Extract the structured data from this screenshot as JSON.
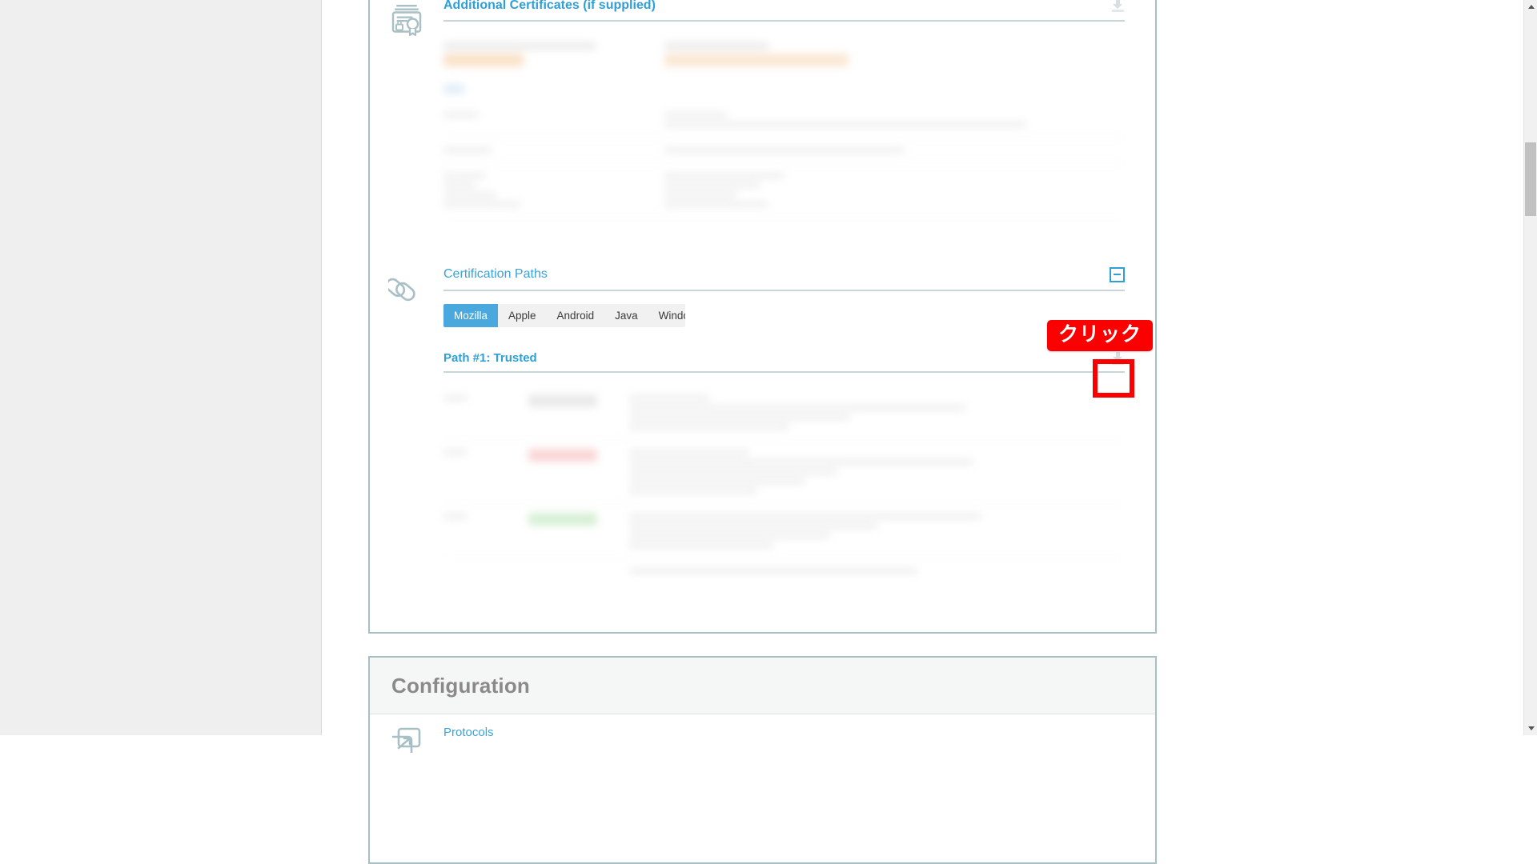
{
  "app": {
    "scroll_hint": "vertical-scrollbar"
  },
  "sections": {
    "additional_certificates": {
      "title": "Additional Certificates (if supplied)",
      "icon": "certificate-icon",
      "download_label": "",
      "content_state": "redacted"
    },
    "certification_paths": {
      "title": "Certification Paths",
      "icon": "chain-link-icon",
      "collapse_label": "",
      "tabs": [
        {
          "label": "Mozilla",
          "active": true
        },
        {
          "label": "Apple",
          "active": false
        },
        {
          "label": "Android",
          "active": false
        },
        {
          "label": "Java",
          "active": false
        },
        {
          "label": "Windows",
          "active": false
        }
      ],
      "path": {
        "title": "Path #1: Trusted",
        "download_label": "",
        "content_state": "redacted"
      }
    }
  },
  "configuration": {
    "title": "Configuration",
    "items": [
      {
        "label": "Protocols",
        "icon": "protocol-arrow-icon"
      }
    ]
  },
  "annotations": {
    "badge_text": "クリック",
    "badge_color": "#fb0000",
    "highlight_target": "path-download-button",
    "highlight_color": "#fb0000"
  },
  "colors": {
    "accent_blue": "#2f9fd8",
    "tab_active": "#49a8dd",
    "panel_border": "#a8c0c4",
    "page_gutter": "#efefef",
    "heading_gray": "#8a8a8a"
  }
}
